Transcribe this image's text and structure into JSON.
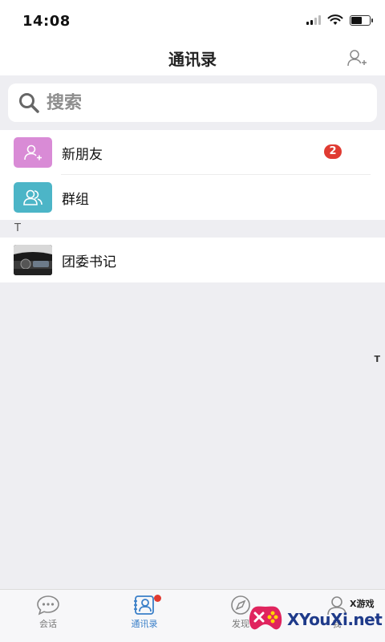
{
  "status_bar": {
    "time": "14:08"
  },
  "nav": {
    "title": "通讯录"
  },
  "search": {
    "placeholder": "搜索"
  },
  "contacts_top": [
    {
      "label": "新朋友",
      "badge": "2",
      "icon": "add-user-icon",
      "color": "#d98bd6"
    },
    {
      "label": "群组",
      "icon": "group-icon",
      "color": "#4cb5c7"
    }
  ],
  "section": {
    "letter": "T"
  },
  "contacts": [
    {
      "label": "团委书记",
      "icon": "car-photo-avatar"
    }
  ],
  "index": {
    "letter": "T"
  },
  "tabs": [
    {
      "label": "会话",
      "icon": "chat-icon",
      "active": false
    },
    {
      "label": "通讯录",
      "icon": "contacts-icon",
      "active": true
    },
    {
      "label": "发现",
      "icon": "compass-icon",
      "active": false
    },
    {
      "label": "我",
      "icon": "profile-icon",
      "active": false
    }
  ],
  "watermark": {
    "small": "X游戏",
    "big": "XYouXi.net"
  },
  "colors": {
    "accent": "#3a7fc8",
    "badge": "#e03b32",
    "background": "#eeeef2"
  }
}
